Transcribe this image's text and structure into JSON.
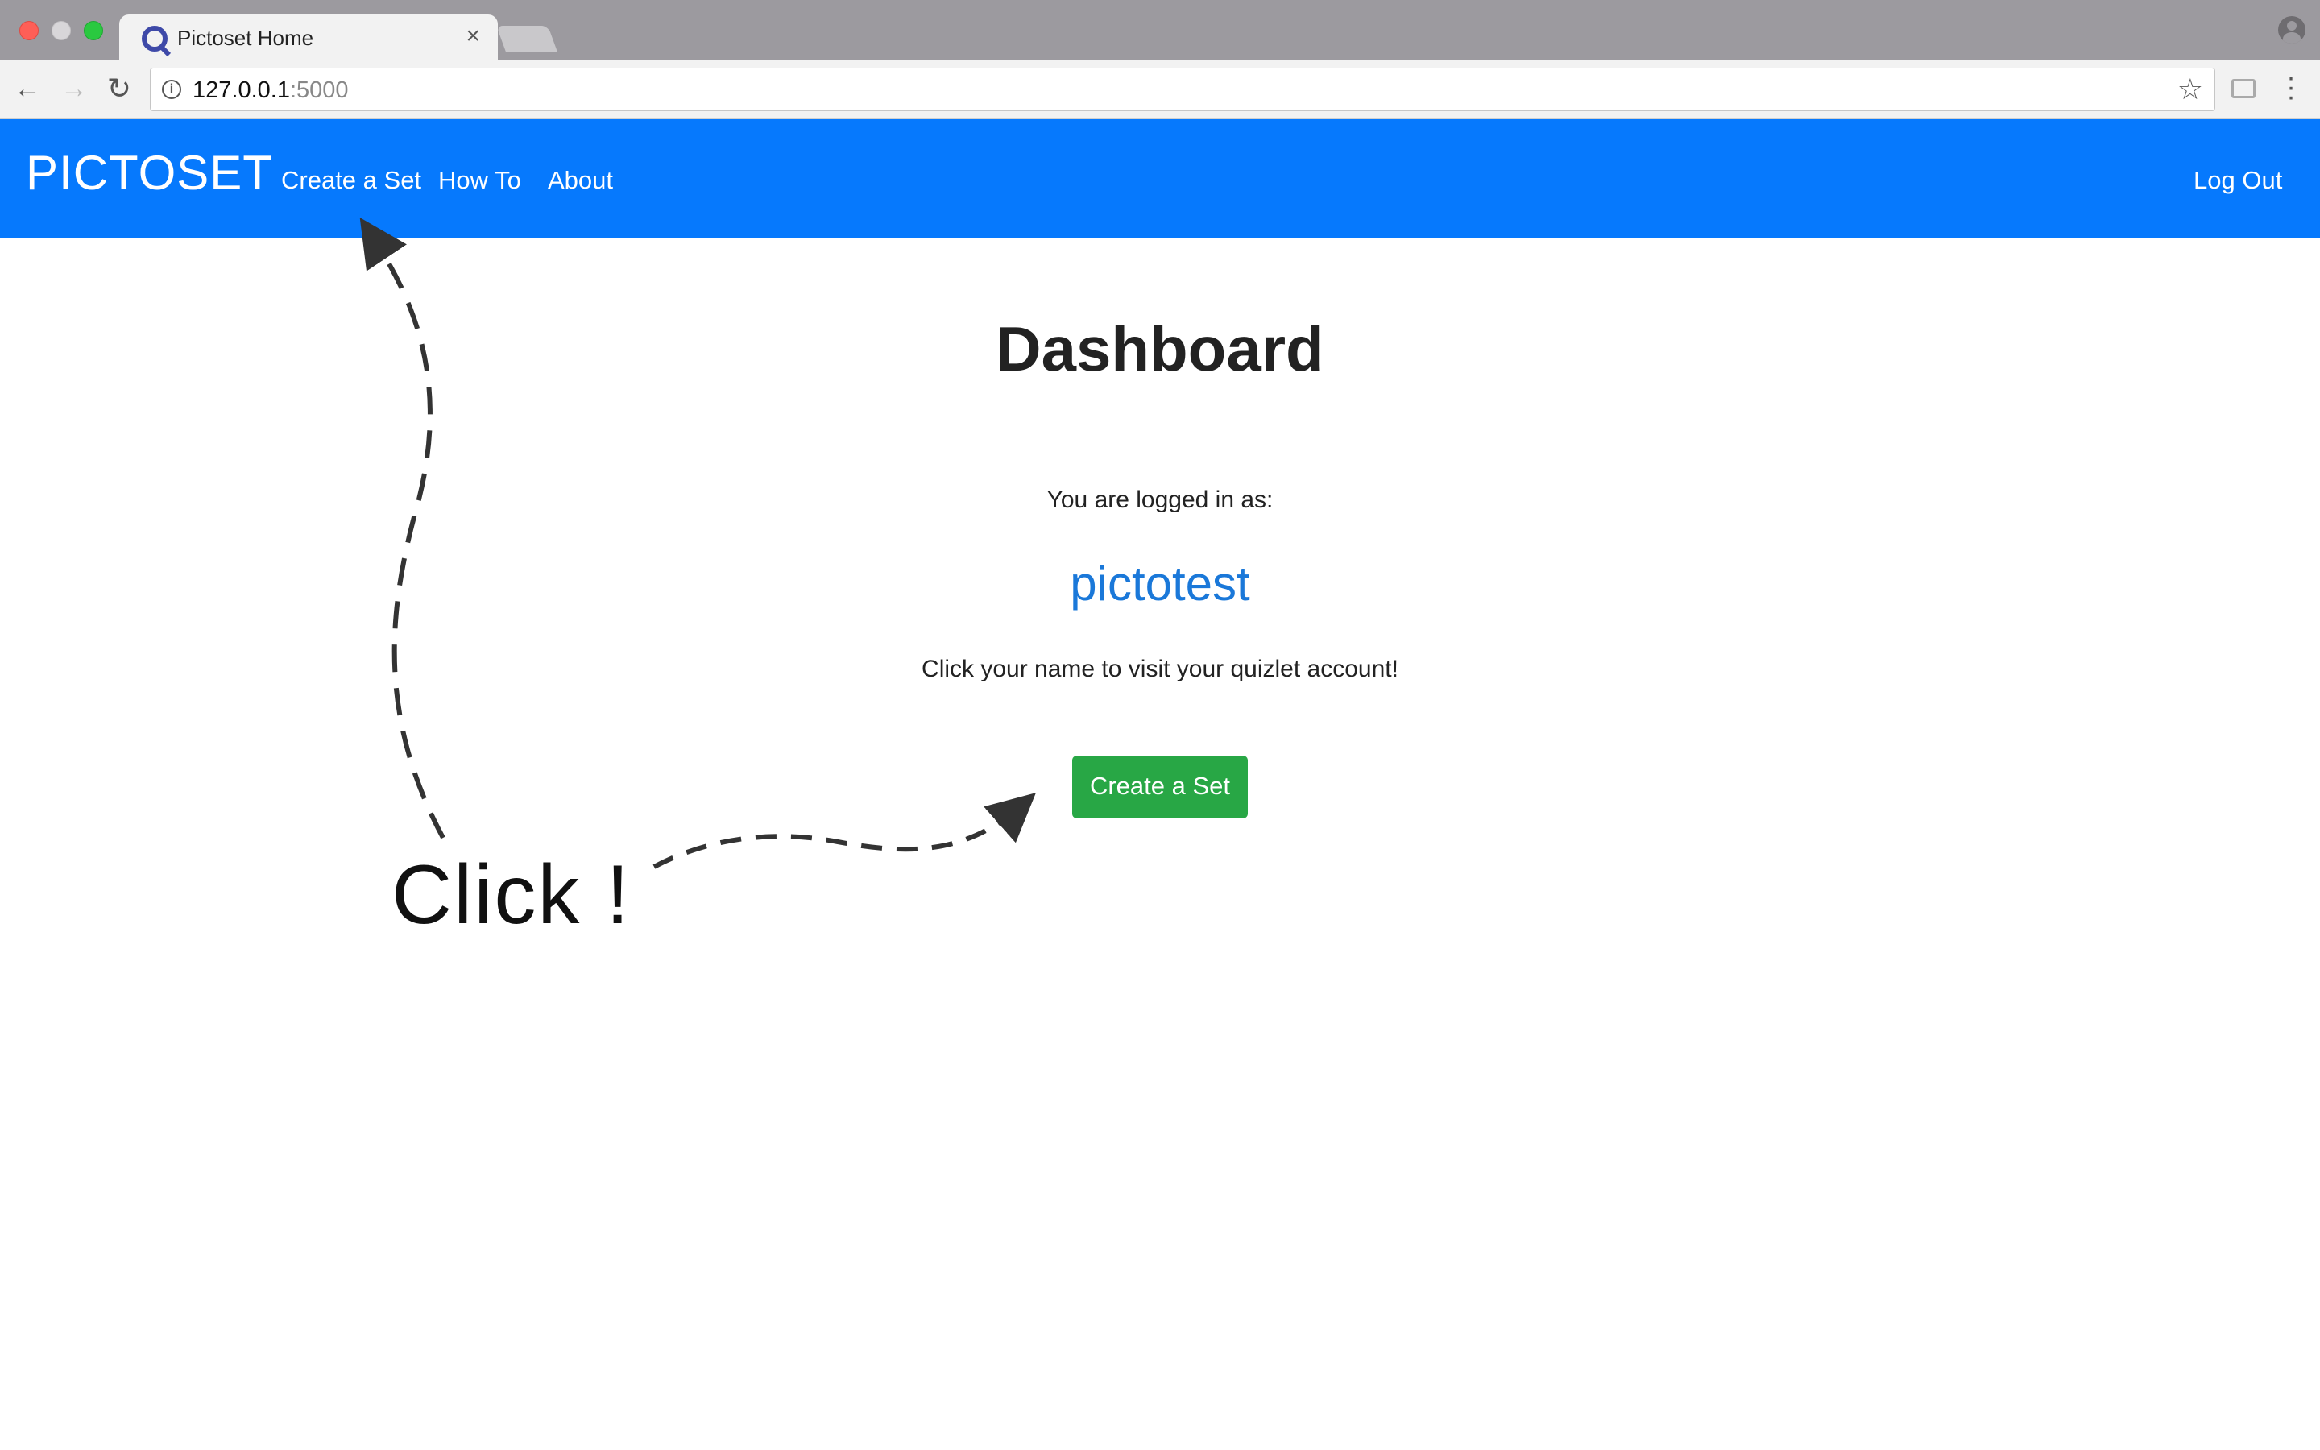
{
  "browser": {
    "tab_title": "Pictoset Home",
    "tab_close": "×",
    "url_host": "127.0.0.1",
    "url_port": ":5000",
    "icons": {
      "back": "arrow-left-icon",
      "forward": "arrow-right-icon",
      "reload": "reload-icon",
      "info": "info-icon",
      "star": "star-icon",
      "cast": "cast-icon",
      "menu": "more-vertical-icon",
      "profile": "profile-icon"
    }
  },
  "navbar": {
    "brand": "PICTOSET",
    "links": {
      "create": "Create a Set",
      "howto": "How To",
      "about": "About",
      "logout": "Log Out"
    },
    "color": "#0679fd"
  },
  "main": {
    "title": "Dashboard",
    "logged_in_label": "You are logged in as:",
    "username": "pictotest",
    "quizlet_hint": "Click your name to visit your quizlet account!",
    "create_button": "Create a Set",
    "button_color": "#28a745",
    "username_color": "#1a78d9"
  },
  "annotation": {
    "text": "Click !"
  }
}
